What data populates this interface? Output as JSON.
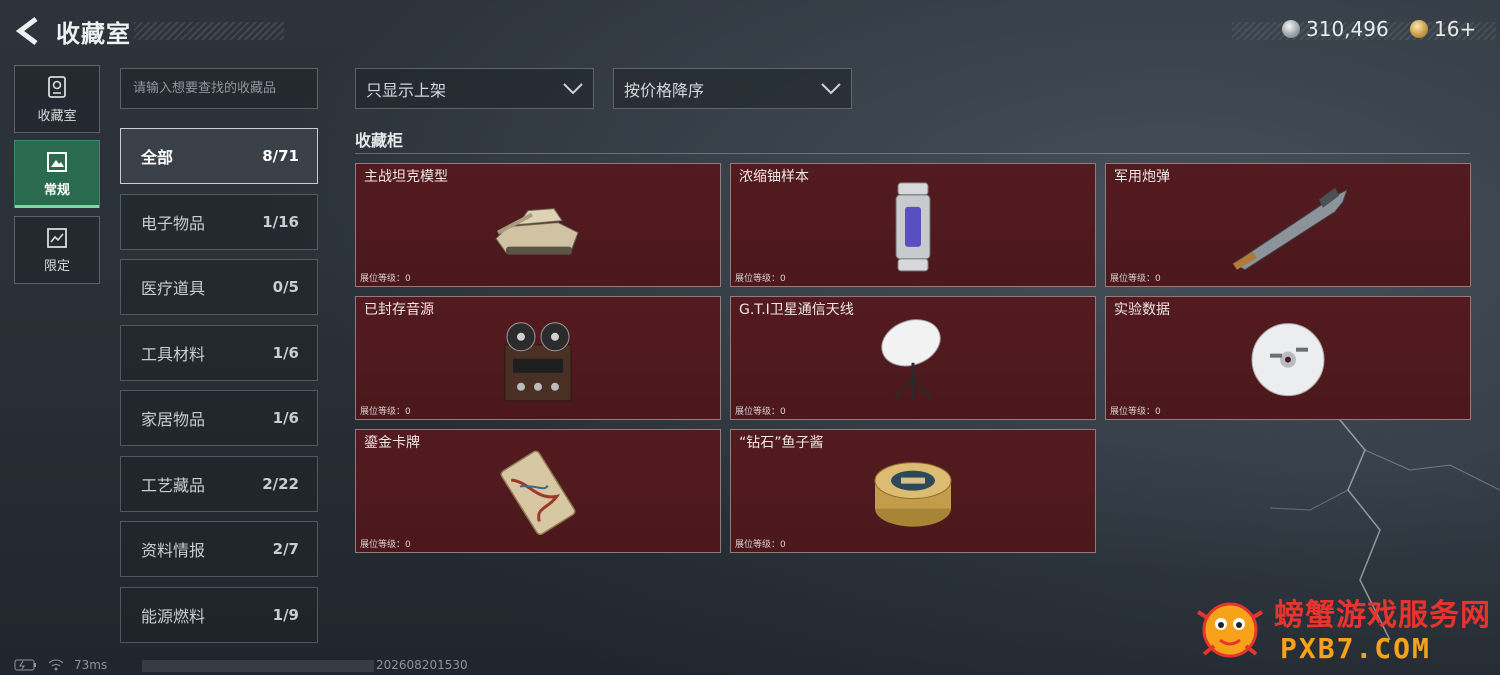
{
  "header": {
    "title": "收藏室",
    "currency_silver": "310,496",
    "currency_gold": "16+"
  },
  "nav": [
    {
      "label": "收藏室",
      "icon": "vault-icon"
    },
    {
      "label": "常规",
      "icon": "image-frame-icon",
      "active": true
    },
    {
      "label": "限定",
      "icon": "limited-frame-icon"
    }
  ],
  "search": {
    "placeholder": "请输入想要查找的收藏品",
    "value": ""
  },
  "categories": [
    {
      "label": "全部",
      "count": "8/71",
      "active": true
    },
    {
      "label": "电子物品",
      "count": "1/16"
    },
    {
      "label": "医疗道具",
      "count": "0/5"
    },
    {
      "label": "工具材料",
      "count": "1/6"
    },
    {
      "label": "家居物品",
      "count": "1/6"
    },
    {
      "label": "工艺藏品",
      "count": "2/22"
    },
    {
      "label": "资料情报",
      "count": "2/7"
    },
    {
      "label": "能源燃料",
      "count": "1/9"
    }
  ],
  "filters": {
    "display": "只显示上架",
    "sort": "按价格降序"
  },
  "section": {
    "title": "收藏柜"
  },
  "items": [
    {
      "name": "主战坦克模型",
      "level": "展位等级：0",
      "icon": "tank-model-icon"
    },
    {
      "name": "浓缩铀样本",
      "level": "展位等级：0",
      "icon": "uranium-canister-icon"
    },
    {
      "name": "军用炮弹",
      "level": "展位等级：0",
      "icon": "artillery-shell-icon"
    },
    {
      "name": "已封存音源",
      "level": "展位等级：0",
      "icon": "tape-recorder-icon"
    },
    {
      "name": "G.T.I卫星通信天线",
      "level": "展位等级：0",
      "icon": "satellite-dish-icon"
    },
    {
      "name": "实验数据",
      "level": "展位等级：0",
      "icon": "disc-icon"
    },
    {
      "name": "鎏金卡牌",
      "level": "展位等级：0",
      "icon": "gilded-card-icon"
    },
    {
      "name": "“钻石”鱼子酱",
      "level": "展位等级：0",
      "icon": "caviar-tin-icon"
    }
  ],
  "status": {
    "ping": "73ms",
    "build": "202608201530"
  },
  "watermark": {
    "line1": "螃蟹游戏服务网",
    "line2": "PXB7.COM"
  },
  "colors": {
    "card_bg": "#531b1f",
    "active_nav": "#2a6b4f",
    "accent_green": "#7ed8a4"
  }
}
